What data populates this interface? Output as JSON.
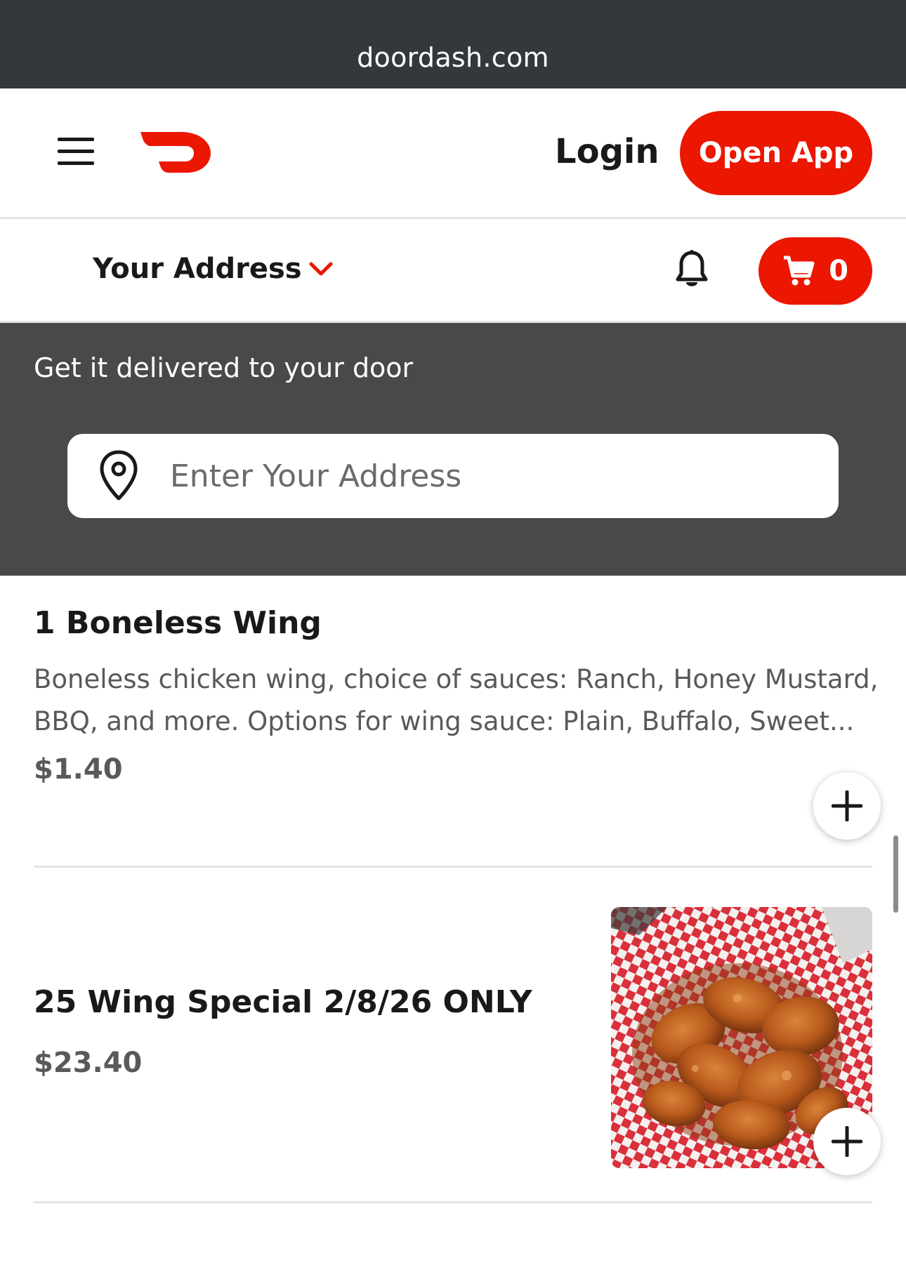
{
  "browser": {
    "url": "doordash.com"
  },
  "nav": {
    "login_label": "Login",
    "open_app_label": "Open App",
    "brand_color": "#eb1700"
  },
  "address_bar": {
    "label": "Your Address",
    "cart_count": "0",
    "icons": [
      "hamburger-menu-icon",
      "doordash-logo",
      "chevron-down-icon",
      "bell-icon",
      "cart-icon"
    ]
  },
  "banner": {
    "headline": "Get it delivered to your door",
    "address_placeholder": "Enter Your Address",
    "address_value": ""
  },
  "menu_items": [
    {
      "name": "1 Boneless Wing",
      "description_line1": "Boneless chicken wing, choice of sauces: Ranch, Honey Mustard,",
      "description_line2": "BBQ, and more. Options for wing sauce: Plain, Buffalo, Sweet...",
      "price": "$1.40",
      "has_image": false
    },
    {
      "name": "25 Wing Special 2/8/26 ONLY",
      "price": "$23.40",
      "has_image": true,
      "image_subject": "basket of seasoned chicken wings on red checkered paper"
    }
  ]
}
